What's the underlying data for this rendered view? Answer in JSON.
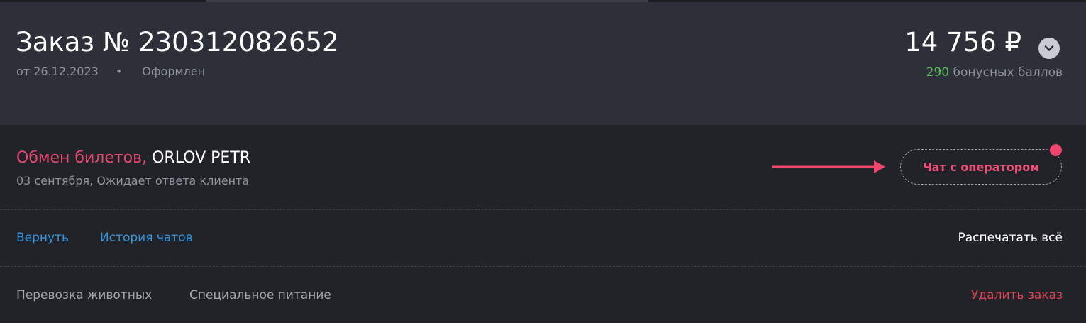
{
  "order": {
    "title": "Заказ № 230312082652",
    "date": "от 26.12.2023",
    "separator": "•",
    "status": "Оформлен",
    "total": "14 756 ₽",
    "bonus_points": "290",
    "bonus_label": "бонусных баллов"
  },
  "request": {
    "type": "Обмен билетов,",
    "name": "ORLOV PETR",
    "subtitle": "03 сентября, Ожидает ответа клиента",
    "chat_button": "Чат с оператором"
  },
  "actions": {
    "return": "Вернуть",
    "chat_history": "История чатов",
    "print_all": "Распечатать всё"
  },
  "services": {
    "animals": "Перевозка животных",
    "meals": "Специальное питание",
    "delete_order": "Удалить заказ"
  },
  "colors": {
    "accent_pink": "#f04f78",
    "link_blue": "#3594dd",
    "bonus_green": "#5cb85c",
    "delete_red": "#e04355"
  },
  "icons": {
    "expand": "chevron-down-icon",
    "arrow": "arrow-right-icon",
    "notification": "notification-dot-icon"
  }
}
